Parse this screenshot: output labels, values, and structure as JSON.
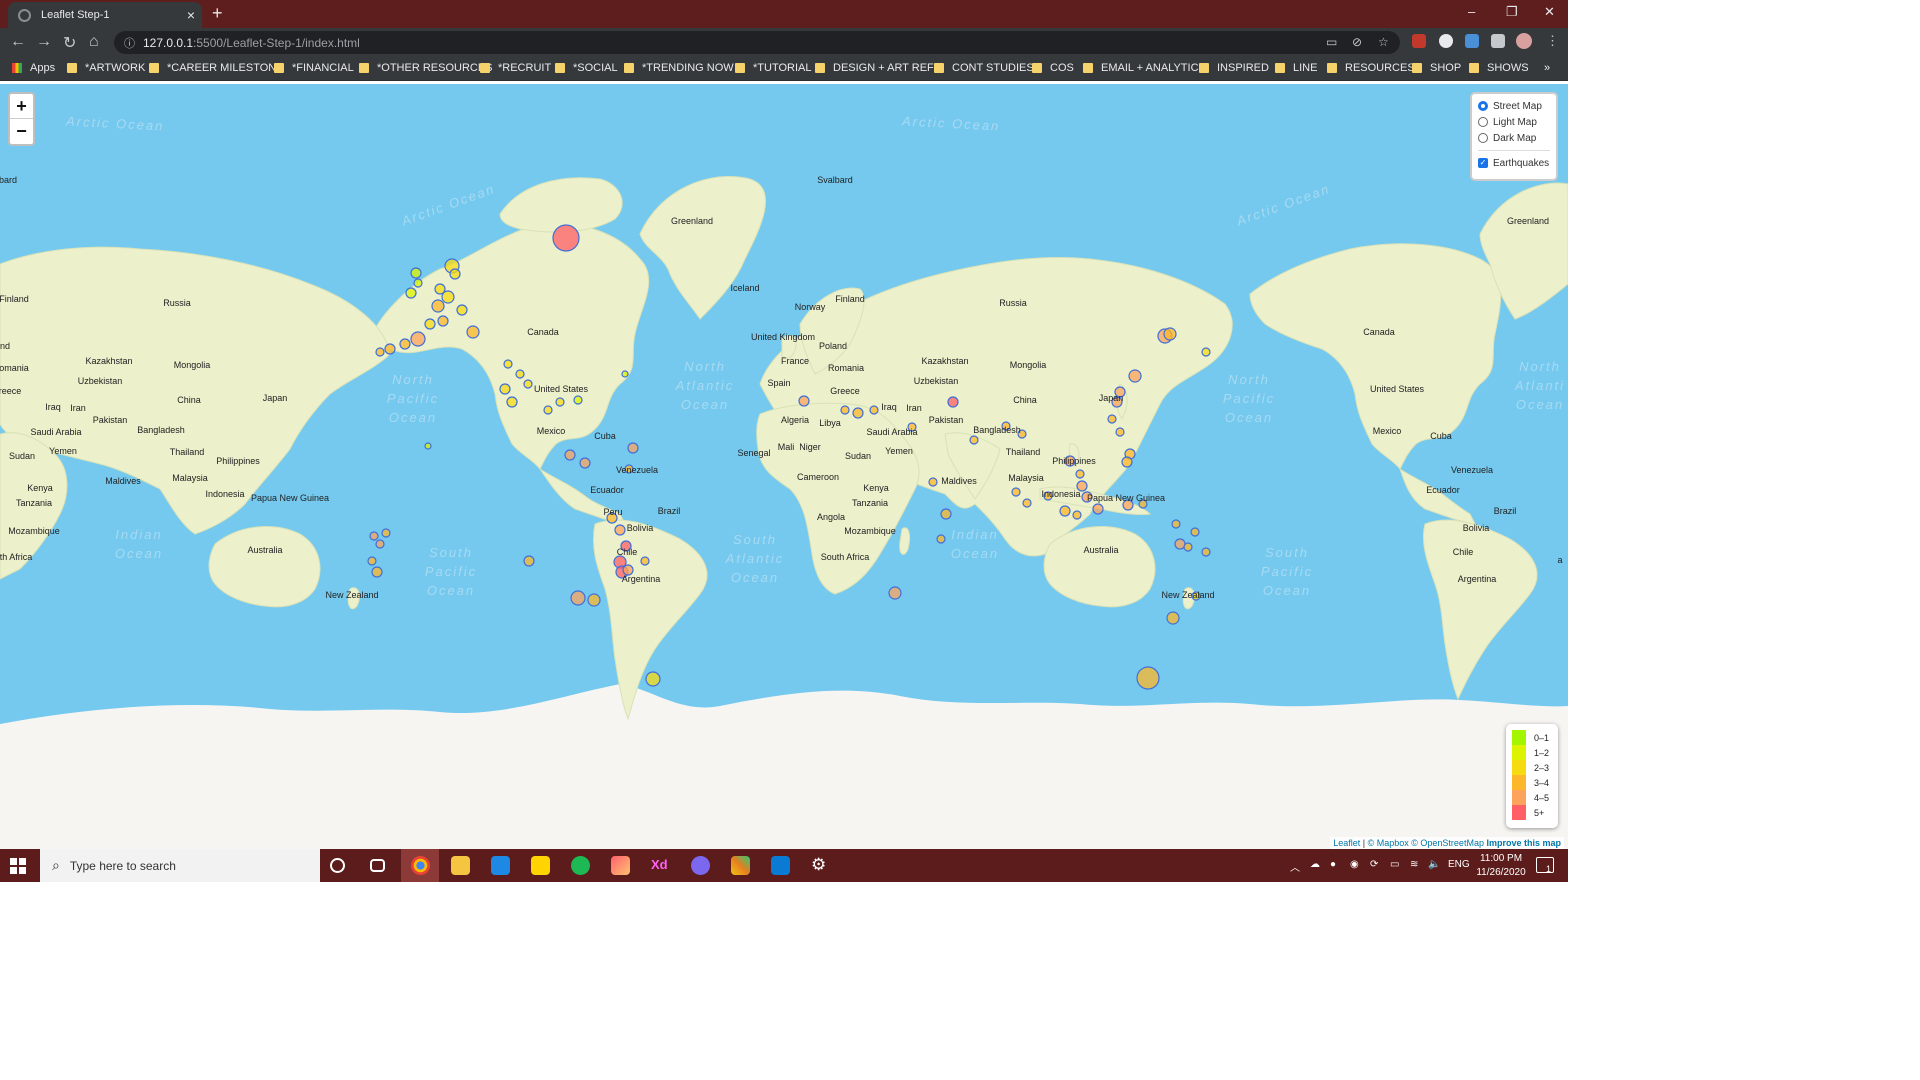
{
  "browser": {
    "tab_title": "Leaflet Step-1",
    "new_tab": "+",
    "close_tab": "×",
    "url_host": "127.0.0.1",
    "url_path": ":5500/Leaflet-Step-1/index.html",
    "window_controls": [
      "–",
      "❐",
      "✕"
    ]
  },
  "bookmarks": [
    "Apps",
    "*ARTWORK",
    "*CAREER MILESTONE",
    "*FINANCIAL",
    "*OTHER RESOURCES",
    "*RECRUIT",
    "*SOCIAL",
    "*TRENDING NOW",
    "*TUTORIAL",
    "DESIGN + ART REFS",
    "CONT STUDIES",
    "COS",
    "EMAIL + ANALYTIC",
    "INSPIRED",
    "LINE",
    "RESOURCES",
    "SHOP",
    "SHOWS"
  ],
  "map": {
    "zoom_in": "+",
    "zoom_out": "−",
    "layers": {
      "base": [
        {
          "label": "Street Map",
          "selected": true
        },
        {
          "label": "Light Map",
          "selected": false
        },
        {
          "label": "Dark Map",
          "selected": false
        }
      ],
      "overlay": {
        "label": "Earthquakes",
        "checked": true
      }
    },
    "legend": [
      {
        "label": "0–1",
        "color": "#a3f600"
      },
      {
        "label": "1–2",
        "color": "#dcf400"
      },
      {
        "label": "2–3",
        "color": "#f7db11"
      },
      {
        "label": "3–4",
        "color": "#fdb72a"
      },
      {
        "label": "4–5",
        "color": "#fca35d"
      },
      {
        "label": "5+",
        "color": "#ff5f65"
      }
    ],
    "attribution": {
      "leaflet": "Leaflet",
      "mapbox": "© Mapbox",
      "osm": "© OpenStreetMap",
      "improve": "Improve this map",
      "sep": "|"
    },
    "labels": {
      "greenland": "Greenland",
      "greenland2": "Greenland",
      "svalbard": "Svalbard",
      "iceland": "Iceland",
      "russia": "Russia",
      "russia2": "Russia",
      "finland": "Finland",
      "finland2": "Finland",
      "norway": "Norway",
      "uk": "United Kingdom",
      "poland": "Poland",
      "france": "France",
      "romania": "Romania",
      "romania2": "Romania",
      "spain": "Spain",
      "greece": "Greece",
      "greece2": "Greece",
      "kazakhstan": "Kazakhstan",
      "kazakhstan2": "Kazakhstan",
      "mongolia": "Mongolia",
      "mongolia2": "Mongolia",
      "uzbekistan": "Uzbekistan",
      "uzbekistan2": "Uzbekistan",
      "china": "China",
      "china2": "China",
      "japan": "Japan",
      "japan2": "Japan",
      "iraq": "Iraq",
      "iraq2": "Iraq",
      "iran": "Iran",
      "iran2": "Iran",
      "pakistan": "Pakistan",
      "pakistan2": "Pakistan",
      "saudi": "Saudi Arabia",
      "saudi2": "Saudi Arabia",
      "bangladesh": "Bangladesh",
      "bangladesh2": "Bangladesh",
      "yemen": "Yemen",
      "yemen2": "Yemen",
      "thailand": "Thailand",
      "thailand2": "Thailand",
      "philippines": "Philippines",
      "philippines2": "Philippines",
      "sudan": "Sudan",
      "sudan2": "Sudan",
      "malaysia": "Malaysia",
      "malaysia2": "Malaysia",
      "kenya": "Kenya",
      "kenya2": "Kenya",
      "maldives": "Maldives",
      "maldives2": "Maldives",
      "indonesia": "Indonesia",
      "indonesia2": "Indonesia",
      "png": "Papua New Guinea",
      "png2": "Papua New Guinea",
      "tanzania": "Tanzania",
      "tanzania2": "Tanzania",
      "mozambique": "Mozambique",
      "mozambique2": "Mozambique",
      "southafrica": "th Africa",
      "southafrica2": "South Africa",
      "australia": "Australia",
      "australia2": "Australia",
      "newzealand": "New Zealand",
      "newzealand2": "New Zealand",
      "canada": "Canada",
      "canada2": "Canada",
      "usa": "United States",
      "usa2": "United States",
      "mexico": "Mexico",
      "mexico2": "Mexico",
      "cuba": "Cuba",
      "cuba2": "Cuba",
      "venezuela": "Venezuela",
      "venezuela2": "Venezuela",
      "ecuador": "Ecuador",
      "ecuador2": "Ecuador",
      "peru": "Peru",
      "brazil": "Brazil",
      "brazil2": "Brazil",
      "bolivia": "Bolivia",
      "bolivia2": "Bolivia",
      "chile": "Chile",
      "chile2": "Chile",
      "argentina": "Argentina",
      "argentina2": "Argentina",
      "algeria": "Algeria",
      "libya": "Libya",
      "senegal": "Senegal",
      "mali": "Mali",
      "niger": "Niger",
      "cameroon": "Cameroon",
      "angola": "Angola",
      "bard": "bard",
      "nd": "nd",
      "omania": "omania",
      "reece": "reece",
      "a": "a",
      "arctic1": "Arctic Ocean",
      "arctic2": "Arctic Ocean",
      "arctic3": "Arctic Ocean",
      "arctic4": "Arctic Ocean",
      "arctic5": "Arctic Ocean",
      "npac1": [
        "North",
        "Pacific",
        "Ocean"
      ],
      "npac2": [
        "North",
        "Pacific",
        "Ocean"
      ],
      "spac1": [
        "South",
        "Pacific",
        "Ocean"
      ],
      "spac2": [
        "South",
        "Pacific",
        "Ocean"
      ],
      "natl1": [
        "North",
        "Atlantic",
        "Ocean"
      ],
      "natl2": [
        "North",
        "Atlanti",
        "Ocean"
      ],
      "satl": [
        "South",
        "Atlantic",
        "Ocean"
      ],
      "ind1": [
        "Indian",
        "Ocean"
      ],
      "ind2": [
        "Indian",
        "Ocean"
      ]
    }
  },
  "taskbar": {
    "search_placeholder": "Type here to search",
    "lang": "ENG",
    "time": "11:00 PM",
    "date": "11/26/2020",
    "notifications": "1"
  }
}
